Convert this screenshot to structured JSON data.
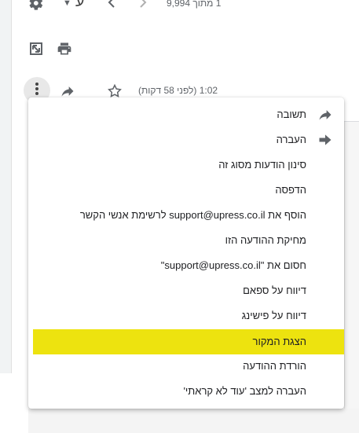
{
  "toolbar": {
    "count_text": "1 מתוך 9,994",
    "language_glyph": "ע"
  },
  "message": {
    "time_text": "1:02 (לפני 58 דקות)"
  },
  "menu": {
    "items": [
      {
        "label": "תשובה",
        "icon": "reply-icon"
      },
      {
        "label": "העברה",
        "icon": "forward-icon"
      },
      {
        "label": "סינון הודעות מסוג זה"
      },
      {
        "label": "הדפסה"
      },
      {
        "label": "הוסף את support@upress.co.il לרשימת אנשי הקשר"
      },
      {
        "label": "מחיקת ההודעה הזו"
      },
      {
        "label": "חסום את \"support@upress.co.il\""
      },
      {
        "label": "דיווח על ספאם"
      },
      {
        "label": "דיווח על פישינג"
      },
      {
        "label": "הצגת המקור",
        "highlighted": true
      },
      {
        "label": "הורדת ההודעה"
      },
      {
        "label": "העברה למצב 'עוד לא קראתי'"
      }
    ],
    "highlight_color": "#ede30f"
  }
}
